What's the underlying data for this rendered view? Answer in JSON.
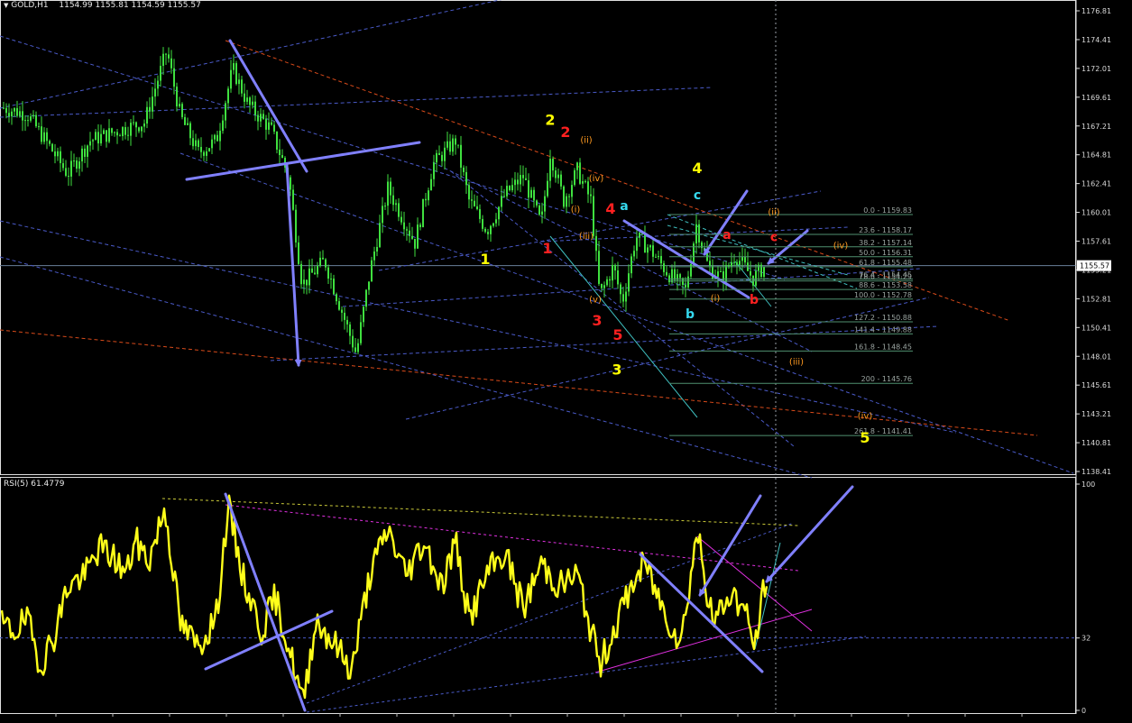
{
  "header": {
    "symbol": "GOLD,H1",
    "ohlc": "1154.99 1155.81 1154.59 1155.57"
  },
  "rsi_header": "RSI(5) 61.4779",
  "current_price_label": "1155.57",
  "colors": {
    "background": "#000000",
    "candles": "#3fe03f",
    "rsi_line": "#ffff1a",
    "trend_arrows": "#8080ff",
    "channel_lines": "#4a5ac8",
    "label_yellow": "#ffff00",
    "label_red": "#ff2020",
    "label_cyan": "#35d9ef",
    "label_orange": "#ff9a20"
  },
  "chart_data": [
    {
      "type": "candlestick",
      "title": "GOLD,H1",
      "ylim": [
        1138.41,
        1177.71
      ],
      "y_ticks": [
        "1176.81",
        "1174.41",
        "1172.01",
        "1169.61",
        "1167.21",
        "1164.81",
        "1162.41",
        "1160.01",
        "1157.61",
        "1155.21",
        "1152.81",
        "1150.41",
        "1148.01",
        "1145.61",
        "1143.21",
        "1140.81",
        "1138.41"
      ],
      "close_path_approx": [
        {
          "x": 0,
          "y": 1168.8
        },
        {
          "x": 30,
          "y": 1168.2
        },
        {
          "x": 55,
          "y": 1165.5
        },
        {
          "x": 75,
          "y": 1163.2
        },
        {
          "x": 100,
          "y": 1166.0
        },
        {
          "x": 130,
          "y": 1166.8
        },
        {
          "x": 160,
          "y": 1167.5
        },
        {
          "x": 185,
          "y": 1173.5
        },
        {
          "x": 200,
          "y": 1168.0
        },
        {
          "x": 220,
          "y": 1165.0
        },
        {
          "x": 240,
          "y": 1166.0
        },
        {
          "x": 258,
          "y": 1172.0
        },
        {
          "x": 275,
          "y": 1169.0
        },
        {
          "x": 300,
          "y": 1167.0
        },
        {
          "x": 320,
          "y": 1163.0
        },
        {
          "x": 335,
          "y": 1154.0
        },
        {
          "x": 360,
          "y": 1156.0
        },
        {
          "x": 395,
          "y": 1148.2
        },
        {
          "x": 410,
          "y": 1155.0
        },
        {
          "x": 430,
          "y": 1162.0
        },
        {
          "x": 460,
          "y": 1157.5
        },
        {
          "x": 480,
          "y": 1164.0
        },
        {
          "x": 505,
          "y": 1166.0
        },
        {
          "x": 520,
          "y": 1161.0
        },
        {
          "x": 540,
          "y": 1158.5
        },
        {
          "x": 560,
          "y": 1161.5
        },
        {
          "x": 580,
          "y": 1163.0
        },
        {
          "x": 600,
          "y": 1159.0
        },
        {
          "x": 610,
          "y": 1165.0
        },
        {
          "x": 625,
          "y": 1161.0
        },
        {
          "x": 640,
          "y": 1163.5
        },
        {
          "x": 655,
          "y": 1161.0
        },
        {
          "x": 665,
          "y": 1153.0
        },
        {
          "x": 680,
          "y": 1155.5
        },
        {
          "x": 690,
          "y": 1152.5
        },
        {
          "x": 705,
          "y": 1158.0
        },
        {
          "x": 720,
          "y": 1157.0
        },
        {
          "x": 740,
          "y": 1155.0
        },
        {
          "x": 760,
          "y": 1153.5
        },
        {
          "x": 772,
          "y": 1159.0
        },
        {
          "x": 785,
          "y": 1155.5
        },
        {
          "x": 800,
          "y": 1154.5
        },
        {
          "x": 815,
          "y": 1156.5
        },
        {
          "x": 835,
          "y": 1154.5
        },
        {
          "x": 848,
          "y": 1155.57
        }
      ],
      "fibonacci_levels": [
        {
          "ratio": "0.0",
          "price": "1159.83"
        },
        {
          "ratio": "23.6",
          "price": "1158.17"
        },
        {
          "ratio": "38.2",
          "price": "1157.14"
        },
        {
          "ratio": "50.0",
          "price": "1156.31"
        },
        {
          "ratio": "61.8",
          "price": "1155.48"
        },
        {
          "ratio": "76.4",
          "price": "1154.45"
        },
        {
          "ratio": "78.6",
          "price": "1154.29"
        },
        {
          "ratio": "88.6",
          "price": "1153.58"
        },
        {
          "ratio": "100.0",
          "price": "1152.78"
        },
        {
          "ratio": "127.2",
          "price": "1150.88"
        },
        {
          "ratio": "141.4",
          "price": "1149.88"
        },
        {
          "ratio": "161.8",
          "price": "1148.45"
        },
        {
          "ratio": "200",
          "price": "1145.76"
        },
        {
          "ratio": "261.8",
          "price": "1141.41"
        }
      ],
      "wave_labels": [
        {
          "text": "2",
          "color": "yellow",
          "x": 610,
          "y": 1167.3
        },
        {
          "text": "2",
          "color": "red",
          "x": 627,
          "y": 1166.3
        },
        {
          "text": "(ii)",
          "color": "orange",
          "x": 650,
          "y": 1165.8
        },
        {
          "text": "(iv)",
          "color": "orange",
          "x": 661,
          "y": 1162.6
        },
        {
          "text": "(i)",
          "color": "orange",
          "x": 638,
          "y": 1160.0
        },
        {
          "text": "4",
          "color": "red",
          "x": 677,
          "y": 1159.9
        },
        {
          "text": "a",
          "color": "cyan",
          "x": 692,
          "y": 1160.2
        },
        {
          "text": "(iii)",
          "color": "orange",
          "x": 650,
          "y": 1157.8
        },
        {
          "text": "1",
          "color": "yellow",
          "x": 538,
          "y": 1155.7
        },
        {
          "text": "1",
          "color": "red",
          "x": 607,
          "y": 1156.6
        },
        {
          "text": "4",
          "color": "yellow",
          "x": 773,
          "y": 1163.3
        },
        {
          "text": "c",
          "color": "cyan",
          "x": 773,
          "y": 1161.1
        },
        {
          "text": "(ii)",
          "color": "orange",
          "x": 858,
          "y": 1159.8
        },
        {
          "text": "a",
          "color": "red",
          "x": 806,
          "y": 1157.8
        },
        {
          "text": "c",
          "color": "red",
          "x": 858,
          "y": 1157.6
        },
        {
          "text": "(iv)",
          "color": "orange",
          "x": 932,
          "y": 1157.0
        },
        {
          "text": "(v)",
          "color": "orange",
          "x": 660,
          "y": 1152.5
        },
        {
          "text": "(i)",
          "color": "orange",
          "x": 793,
          "y": 1152.6
        },
        {
          "text": "b",
          "color": "red",
          "x": 836,
          "y": 1152.4
        },
        {
          "text": "b",
          "color": "cyan",
          "x": 765,
          "y": 1151.2
        },
        {
          "text": "3",
          "color": "red",
          "x": 662,
          "y": 1150.6
        },
        {
          "text": "5",
          "color": "red",
          "x": 685,
          "y": 1149.4
        },
        {
          "text": "(iii)",
          "color": "orange",
          "x": 883,
          "y": 1147.3
        },
        {
          "text": "3",
          "color": "yellow",
          "x": 684,
          "y": 1146.5
        },
        {
          "text": "(iv)",
          "color": "orange",
          "x": 959,
          "y": 1142.8
        },
        {
          "text": "5",
          "color": "yellow",
          "x": 959,
          "y": 1140.8
        }
      ]
    },
    {
      "type": "line",
      "title": "RSI(5) 61.4779",
      "ylim": [
        0,
        100
      ],
      "y_ticks": [
        "100",
        "32",
        "0"
      ],
      "series": [
        {
          "values_approx": [
            {
              "x": 0,
              "y": 38
            },
            {
              "x": 15,
              "y": 35
            },
            {
              "x": 30,
              "y": 40
            },
            {
              "x": 45,
              "y": 20
            },
            {
              "x": 60,
              "y": 33
            },
            {
              "x": 75,
              "y": 55
            },
            {
              "x": 95,
              "y": 60
            },
            {
              "x": 110,
              "y": 72
            },
            {
              "x": 125,
              "y": 68
            },
            {
              "x": 140,
              "y": 60
            },
            {
              "x": 150,
              "y": 75
            },
            {
              "x": 165,
              "y": 66
            },
            {
              "x": 183,
              "y": 90
            },
            {
              "x": 200,
              "y": 38
            },
            {
              "x": 220,
              "y": 28
            },
            {
              "x": 240,
              "y": 42
            },
            {
              "x": 253,
              "y": 90
            },
            {
              "x": 270,
              "y": 58
            },
            {
              "x": 290,
              "y": 35
            },
            {
              "x": 305,
              "y": 50
            },
            {
              "x": 320,
              "y": 28
            },
            {
              "x": 336,
              "y": 3
            },
            {
              "x": 350,
              "y": 40
            },
            {
              "x": 370,
              "y": 30
            },
            {
              "x": 390,
              "y": 18
            },
            {
              "x": 410,
              "y": 60
            },
            {
              "x": 430,
              "y": 80
            },
            {
              "x": 450,
              "y": 60
            },
            {
              "x": 470,
              "y": 75
            },
            {
              "x": 490,
              "y": 55
            },
            {
              "x": 505,
              "y": 75
            },
            {
              "x": 520,
              "y": 40
            },
            {
              "x": 540,
              "y": 60
            },
            {
              "x": 560,
              "y": 70
            },
            {
              "x": 580,
              "y": 45
            },
            {
              "x": 600,
              "y": 65
            },
            {
              "x": 620,
              "y": 55
            },
            {
              "x": 640,
              "y": 60
            },
            {
              "x": 665,
              "y": 20
            },
            {
              "x": 685,
              "y": 40
            },
            {
              "x": 700,
              "y": 55
            },
            {
              "x": 715,
              "y": 65
            },
            {
              "x": 735,
              "y": 45
            },
            {
              "x": 755,
              "y": 30
            },
            {
              "x": 773,
              "y": 80
            },
            {
              "x": 790,
              "y": 38
            },
            {
              "x": 810,
              "y": 52
            },
            {
              "x": 825,
              "y": 45
            },
            {
              "x": 837,
              "y": 28
            },
            {
              "x": 850,
              "y": 61.48
            }
          ]
        }
      ]
    }
  ]
}
